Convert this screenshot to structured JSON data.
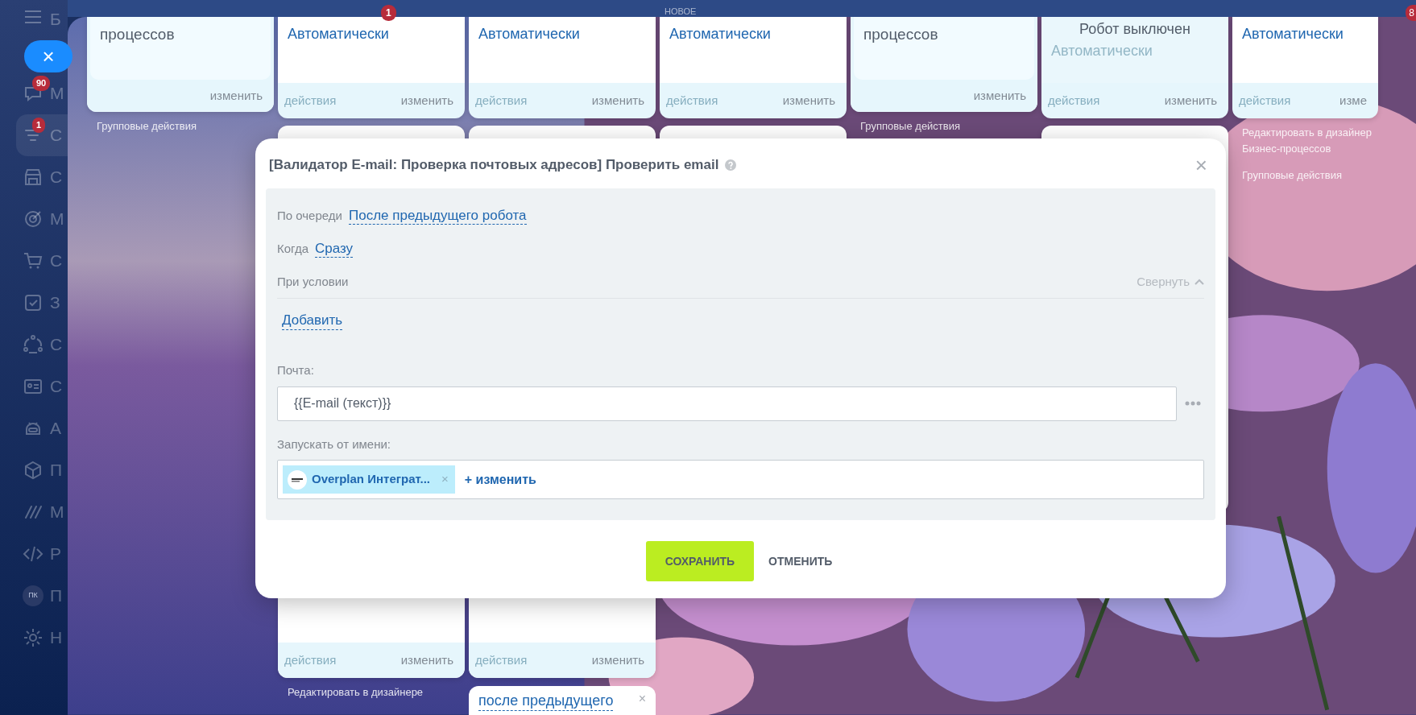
{
  "sidebar": {
    "logo_letter": "Б",
    "items": [
      {
        "label": "М",
        "badge": "90",
        "selected": false
      },
      {
        "label": "С",
        "badge": "1",
        "selected": true
      },
      {
        "label": "С",
        "selected": false
      },
      {
        "label": "М",
        "selected": false
      },
      {
        "label": "С",
        "selected": false
      },
      {
        "label": "З",
        "selected": false
      },
      {
        "label": "С",
        "selected": false
      },
      {
        "label": "С",
        "selected": false
      },
      {
        "label": "А",
        "selected": false
      },
      {
        "label": "П",
        "selected": false
      },
      {
        "label": "М",
        "selected": false
      },
      {
        "label": "Р",
        "selected": false
      },
      {
        "label": "П",
        "avatar": "ПК",
        "selected": false
      },
      {
        "label": "Н",
        "selected": false
      }
    ]
  },
  "close_button": {
    "label": "×"
  },
  "columns": [
    {
      "blocks": [
        {
          "kind": "card",
          "description": "процессов",
          "edit": "изменить"
        },
        {
          "kind": "note",
          "text": "Групповые действия"
        }
      ]
    },
    {
      "top_badge": "1",
      "blocks": [
        {
          "kind": "card",
          "title": "Автоматически",
          "actions": "действия",
          "edit": "изменить"
        },
        {
          "kind": "covered",
          "actions": "действия",
          "edit": "изменить"
        },
        {
          "kind": "note",
          "text": "Редактировать в дизайнере"
        }
      ]
    },
    {
      "blocks": [
        {
          "kind": "card",
          "title": "Автоматически",
          "actions": "действия",
          "edit": "изменить"
        },
        {
          "kind": "covered",
          "actions": "действия",
          "edit": "изменить"
        },
        {
          "kind": "link_card",
          "link": "после предыдущего",
          "close": "×"
        }
      ]
    },
    {
      "top_label": "НОВОЕ",
      "blocks": [
        {
          "kind": "card",
          "title": "Автоматически",
          "actions": "действия",
          "edit": "изменить"
        },
        {
          "kind": "covered"
        }
      ]
    },
    {
      "blocks": [
        {
          "kind": "card",
          "description": "процессов",
          "edit": "изменить"
        },
        {
          "kind": "note",
          "text": "Групповые действия"
        }
      ]
    },
    {
      "blocks": [
        {
          "kind": "card",
          "status": "Робот выключен",
          "title": "Автоматически",
          "disabled": true,
          "actions": "действия",
          "edit": "изменить"
        },
        {
          "kind": "covered"
        }
      ]
    },
    {
      "blocks": [
        {
          "kind": "card",
          "title": "Автоматически",
          "actions": "действия",
          "edit": "изме"
        },
        {
          "kind": "note",
          "text": "Редактировать в дизайнер Бизнес-процессов"
        },
        {
          "kind": "note",
          "text": "Групповые действия"
        }
      ]
    }
  ],
  "edge_badge": "8",
  "dialog": {
    "title": "[Валидатор E-mail: Проверка почтовых адресов] Проверить email",
    "close": "×",
    "order": {
      "label": "По очереди",
      "value": "После предыдущего робота"
    },
    "when": {
      "label": "Когда",
      "value": "Сразу"
    },
    "condition": {
      "label": "При условии",
      "toggle": "Свернуть",
      "expanded": true,
      "add": "Добавить"
    },
    "fields": [
      {
        "label": "Почта:",
        "value": "{{E-mail (текст)}}"
      }
    ],
    "run_as": {
      "label": "Запускать от имени:",
      "user": "Overplan Интеграт...",
      "remove": "×",
      "change": "+ изменить"
    },
    "buttons": [
      {
        "label": "СОХРАНИТЬ",
        "kind": "primary"
      },
      {
        "label": "ОТМЕНИТЬ",
        "kind": "link"
      }
    ]
  }
}
